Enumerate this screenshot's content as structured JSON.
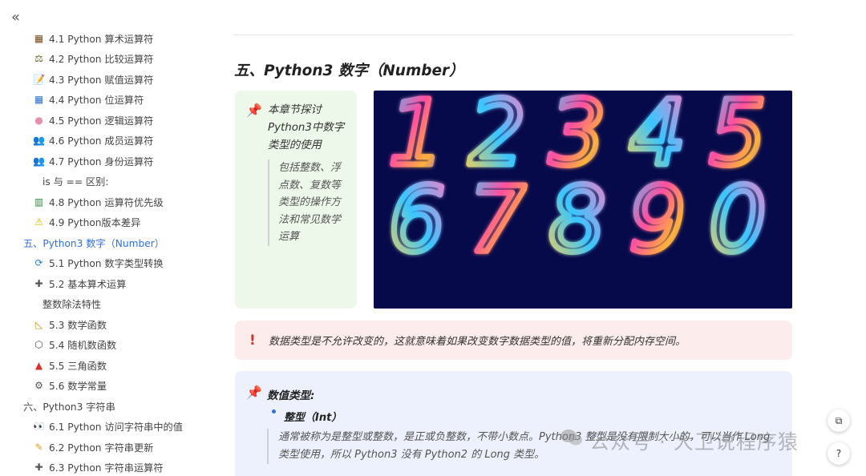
{
  "sidebar": {
    "collapse_label": "«",
    "items": [
      {
        "label": "4.1 Python 算术运算符",
        "icon": "abacus-icon",
        "glyph": "▦",
        "color": "#7a4a1a",
        "level": "lvl2"
      },
      {
        "label": "4.2 Python 比较运算符",
        "icon": "scales-icon",
        "glyph": "⚖",
        "color": "#6a5a2a",
        "level": "lvl2"
      },
      {
        "label": "4.3 Python 赋值运算符",
        "icon": "memo-icon",
        "glyph": "📝",
        "color": "#777",
        "level": "lvl2"
      },
      {
        "label": "4.4 Python 位运算符",
        "icon": "grid-icon",
        "glyph": "▦",
        "color": "#2a6fd0",
        "level": "lvl2"
      },
      {
        "label": "4.5 Python 逻辑运算符",
        "icon": "brain-icon",
        "glyph": "●",
        "color": "#e58fa8",
        "level": "lvl2"
      },
      {
        "label": "4.6 Python 成员运算符",
        "icon": "people-icon",
        "glyph": "👥",
        "color": "#333",
        "level": "lvl2"
      },
      {
        "label": "4.7 Python 身份运算符",
        "icon": "people-icon",
        "glyph": "👥",
        "color": "#333",
        "level": "lvl2"
      },
      {
        "label": "is 与 == 区别:",
        "icon": "",
        "glyph": "",
        "color": "",
        "level": "lvl2-plain"
      },
      {
        "label": "4.8 Python 运算符优先级",
        "icon": "bar-chart-icon",
        "glyph": "▥",
        "color": "#2a8a3a",
        "level": "lvl2"
      },
      {
        "label": "4.9 Python版本差异",
        "icon": "warning-icon",
        "glyph": "⚠",
        "color": "#e6b800",
        "level": "lvl2"
      },
      {
        "label": "五、Python3 数字（Number）",
        "icon": "",
        "glyph": "",
        "color": "",
        "level": "lvl1",
        "active": true
      },
      {
        "label": "5.1 Python 数字类型转换",
        "icon": "refresh-icon",
        "glyph": "⟳",
        "color": "#2a7fd0",
        "level": "lvl2"
      },
      {
        "label": "5.2 基本算术运算",
        "icon": "plus-icon",
        "glyph": "✚",
        "color": "#555",
        "level": "lvl2"
      },
      {
        "label": "整数除法特性",
        "icon": "",
        "glyph": "",
        "color": "",
        "level": "lvl2-plain"
      },
      {
        "label": "5.3 数学函数",
        "icon": "triangle-ruler-icon",
        "glyph": "◺",
        "color": "#c89a1a",
        "level": "lvl2"
      },
      {
        "label": "5.4 随机数函数",
        "icon": "dice-icon",
        "glyph": "⬡",
        "color": "#555",
        "level": "lvl2"
      },
      {
        "label": "5.5 三角函数",
        "icon": "red-triangle-icon",
        "glyph": "▲",
        "color": "#d9302b",
        "level": "lvl2"
      },
      {
        "label": "5.6 数学常量",
        "icon": "gear-icon",
        "glyph": "⚙",
        "color": "#555",
        "level": "lvl2"
      },
      {
        "label": "六、Python3 字符串",
        "icon": "",
        "glyph": "",
        "color": "",
        "level": "lvl1"
      },
      {
        "label": "6.1 Python 访问字符串中的值",
        "icon": "eyes-icon",
        "glyph": "👀",
        "color": "#333",
        "level": "lvl2"
      },
      {
        "label": "6.2 Python 字符串更新",
        "icon": "pencil-icon",
        "glyph": "✎",
        "color": "#d9a21a",
        "level": "lvl2"
      },
      {
        "label": "6.3 Python 字符串运算符",
        "icon": "plus-icon",
        "glyph": "✚",
        "color": "#555",
        "level": "lvl2"
      }
    ]
  },
  "main": {
    "heading": "五、Python3 数字（Number）",
    "callout": {
      "title": "本章节探讨Python3中数字类型的使用",
      "quote": "包括整数、浮点数、复数等类型的操作方法和常见数学运算"
    },
    "hero_digits": [
      "1",
      "2",
      "3",
      "4",
      "5",
      "6",
      "7",
      "8",
      "9",
      "0"
    ],
    "warning": "数据类型是不允许改变的，这就意味着如果改变数字数据类型的值，将重新分配内存空间。",
    "numeric_types": {
      "title": "数值类型:",
      "bullet": "整型（Int）",
      "quote": "通常被称为是整型或整数，是正或负整数，不带小数点。Python3 整型是没有限制大小的，可以当作 Long 类型使用，所以 Python3 没有 Python2 的 Long 类型。"
    }
  },
  "watermark": "公众号 · 大卫说程序猿",
  "colors": {
    "active_link": "#2f6fe0",
    "green_callout": "#eef8ea",
    "warning_bg": "#fdecec",
    "info_bg": "#edf1fd",
    "hero_bg": "#070a4a"
  }
}
